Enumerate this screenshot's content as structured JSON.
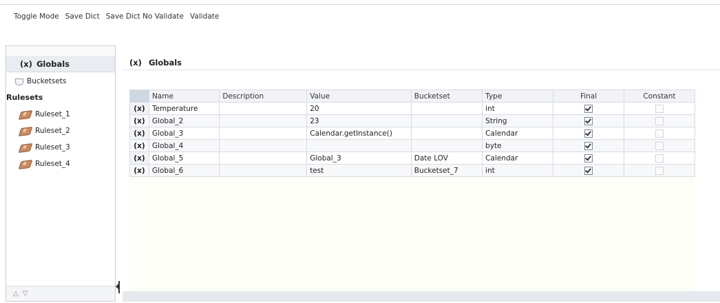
{
  "toolbar": {
    "toggle_mode": "Toggle Mode",
    "save_dict": "Save Dict",
    "save_dict_no_validate": "Save Dict No Validate",
    "validate": "Validate"
  },
  "nav": {
    "globals_prefix": "(x)",
    "globals_label": "Globals",
    "bucketsets_label": "Bucketsets",
    "rulesets_title": "Rulesets",
    "rulesets": [
      "Ruleset_1",
      "Ruleset_2",
      "Ruleset_3",
      "Ruleset_4"
    ],
    "bottom_up": "△",
    "bottom_down": "▽"
  },
  "main": {
    "title_prefix": "(x)",
    "title": "Globals"
  },
  "grid": {
    "columns": [
      "Name",
      "Description",
      "Value",
      "Bucketset",
      "Type",
      "Final",
      "Constant"
    ],
    "row_prefix": "(x)",
    "rows": [
      {
        "name": "Temperature",
        "description": "",
        "value": "20",
        "bucketset": "",
        "type": "int",
        "final": true,
        "constant": false
      },
      {
        "name": "Global_2",
        "description": "",
        "value": "23",
        "bucketset": "",
        "type": "String",
        "final": true,
        "constant": false
      },
      {
        "name": "Global_3",
        "description": "",
        "value": "Calendar.getInstance()",
        "bucketset": "",
        "type": "Calendar",
        "final": true,
        "constant": false
      },
      {
        "name": "Global_4",
        "description": "",
        "value": "",
        "bucketset": "",
        "type": "byte",
        "final": true,
        "constant": false
      },
      {
        "name": "Global_5",
        "description": "",
        "value": "Global_3",
        "bucketset": "Date LOV",
        "type": "Calendar",
        "final": true,
        "constant": false
      },
      {
        "name": "Global_6",
        "description": "",
        "value": "test",
        "bucketset": "Bucketset_7",
        "type": "int",
        "final": true,
        "constant": false
      }
    ]
  }
}
